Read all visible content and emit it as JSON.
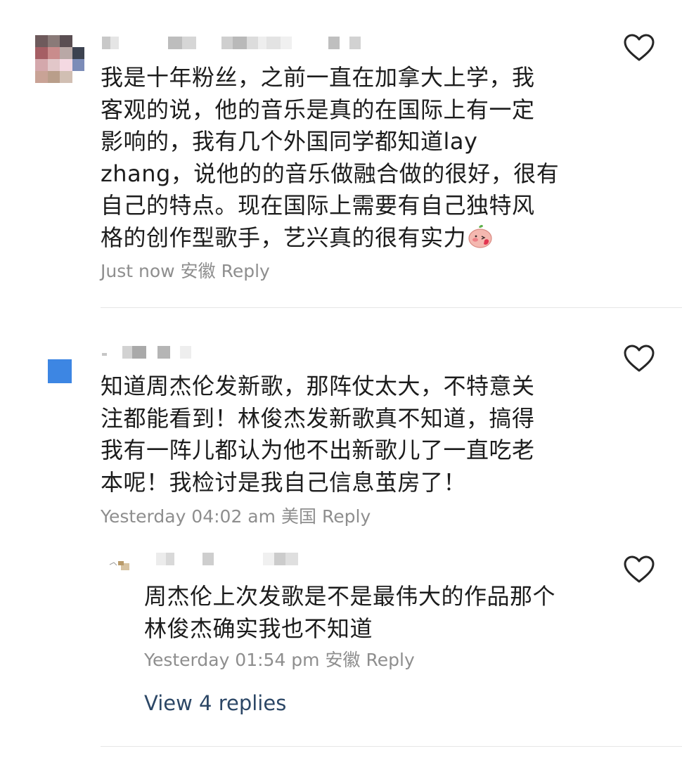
{
  "comments": [
    {
      "text": "我是十年粉丝，之前一直在加拿大上学，我\n客观的说，他的音乐是真的在国际上有一定\n影响的，我有几个外国同学都知道lay\nzhang，说他的的音乐做融合做的很好，很有\n自己的特点。现在国际上需要有自己独特风\n格的创作型歌手，艺兴真的很有实力",
      "time": "Just now",
      "location": "安徽",
      "reply_label": "Reply",
      "emoji": "blushing-face-emoji"
    },
    {
      "text": "知道周杰伦发新歌，那阵仗太大，不特意关\n注都能看到！林俊杰发新歌真不知道，搞得\n我有一阵儿都认为他不出新歌儿了一直吃老\n本呢！我检讨是我自己信息茧房了！",
      "time": "Yesterday 04:02 am",
      "location": "美国",
      "reply_label": "Reply",
      "replies": [
        {
          "text": "周杰伦上次发歌是不是最伟大的作品那个\n林俊杰确实我也不知道",
          "time": "Yesterday 01:54 pm",
          "location": "安徽",
          "reply_label": "Reply"
        }
      ],
      "view_replies_label": "View 4 replies"
    }
  ],
  "icons": {
    "like": "heart-outline-icon"
  },
  "colors": {
    "meta_gray": "#8e8e8e",
    "link_blue": "#2c4766",
    "divider": "#e6e6e6"
  }
}
